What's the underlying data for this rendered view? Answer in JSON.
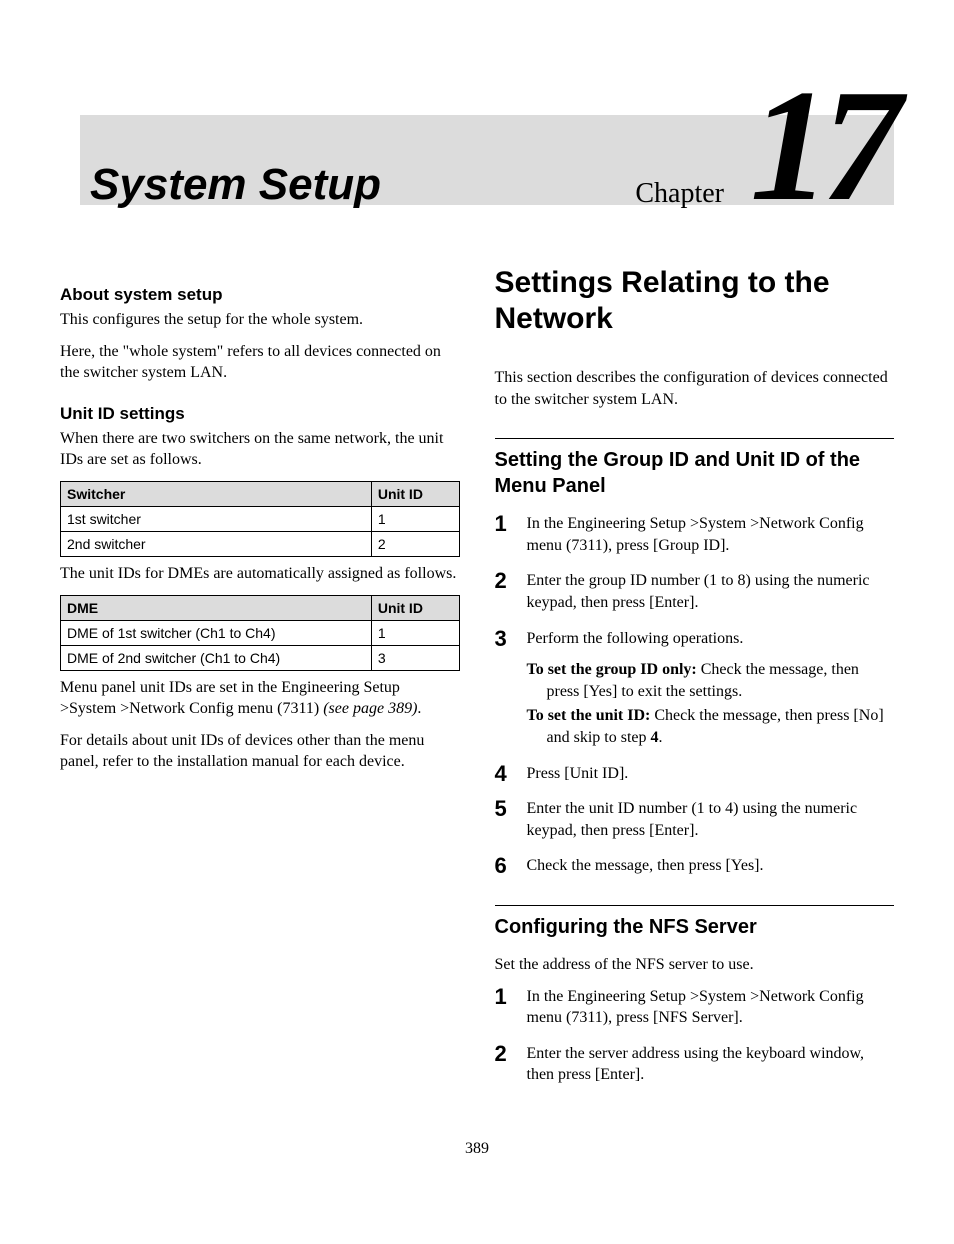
{
  "header": {
    "title": "System Setup",
    "chapterLabel": "Chapter",
    "chapterNumber": "17"
  },
  "left": {
    "about": {
      "heading": "About system setup",
      "p1": "This configures the setup for the whole system.",
      "p2": "Here, the \"whole system\" refers to all devices connected on the switcher system LAN."
    },
    "unitid": {
      "heading": "Unit ID settings",
      "intro": "When there are two switchers on the same network, the unit IDs are set as follows.",
      "table1": {
        "h1": "Switcher",
        "h2": "Unit ID",
        "r1c1": "1st switcher",
        "r1c2": "1",
        "r2c1": "2nd switcher",
        "r2c2": "2"
      },
      "dmeIntro": "The unit IDs for DMEs are automatically assigned as follows.",
      "table2": {
        "h1": "DME",
        "h2": "Unit ID",
        "r1c1": "DME of 1st switcher (Ch1 to Ch4)",
        "r1c2": "1",
        "r2c1": "DME of 2nd switcher (Ch1 to Ch4)",
        "r2c2": "3"
      },
      "menupanel_a": "Menu panel unit IDs are set in the Engineering Setup >System >Network Config menu (7311) ",
      "menupanel_b": "(see page 389)",
      "menupanel_c": ".",
      "details": "For details about unit IDs of devices other than the menu panel, refer to the installation manual for each device."
    }
  },
  "right": {
    "title": "Settings Relating to the Network",
    "intro": "This section describes the configuration of devices connected to the switcher system LAN.",
    "group": {
      "heading": "Setting the Group ID and Unit ID of the Menu Panel",
      "step1": "In the Engineering Setup >System >Network Config menu (7311), press [Group ID].",
      "step2": "Enter the group ID number (1 to 8) using the numeric keypad, then press [Enter].",
      "step3": "Perform the following operations.",
      "step3a_bold": "To set the group ID only:",
      "step3a_rest": " Check the message, then press [Yes] to exit the settings.",
      "step3b_bold": "To set the unit ID:",
      "step3b_rest_a": " Check the message, then press [No] and skip to step ",
      "step3b_rest_b": "4",
      "step3b_rest_c": ".",
      "step4": "Press [Unit ID].",
      "step5": "Enter the unit ID number (1 to 4) using the numeric keypad, then press [Enter].",
      "step6": "Check the message, then press [Yes]."
    },
    "nfs": {
      "heading": "Configuring the NFS Server",
      "intro": "Set the address of the NFS server to use.",
      "step1": "In the Engineering Setup >System >Network Config menu (7311), press [NFS Server].",
      "step2": "Enter the server address using the keyboard window, then press [Enter]."
    }
  },
  "pageNumber": "389"
}
